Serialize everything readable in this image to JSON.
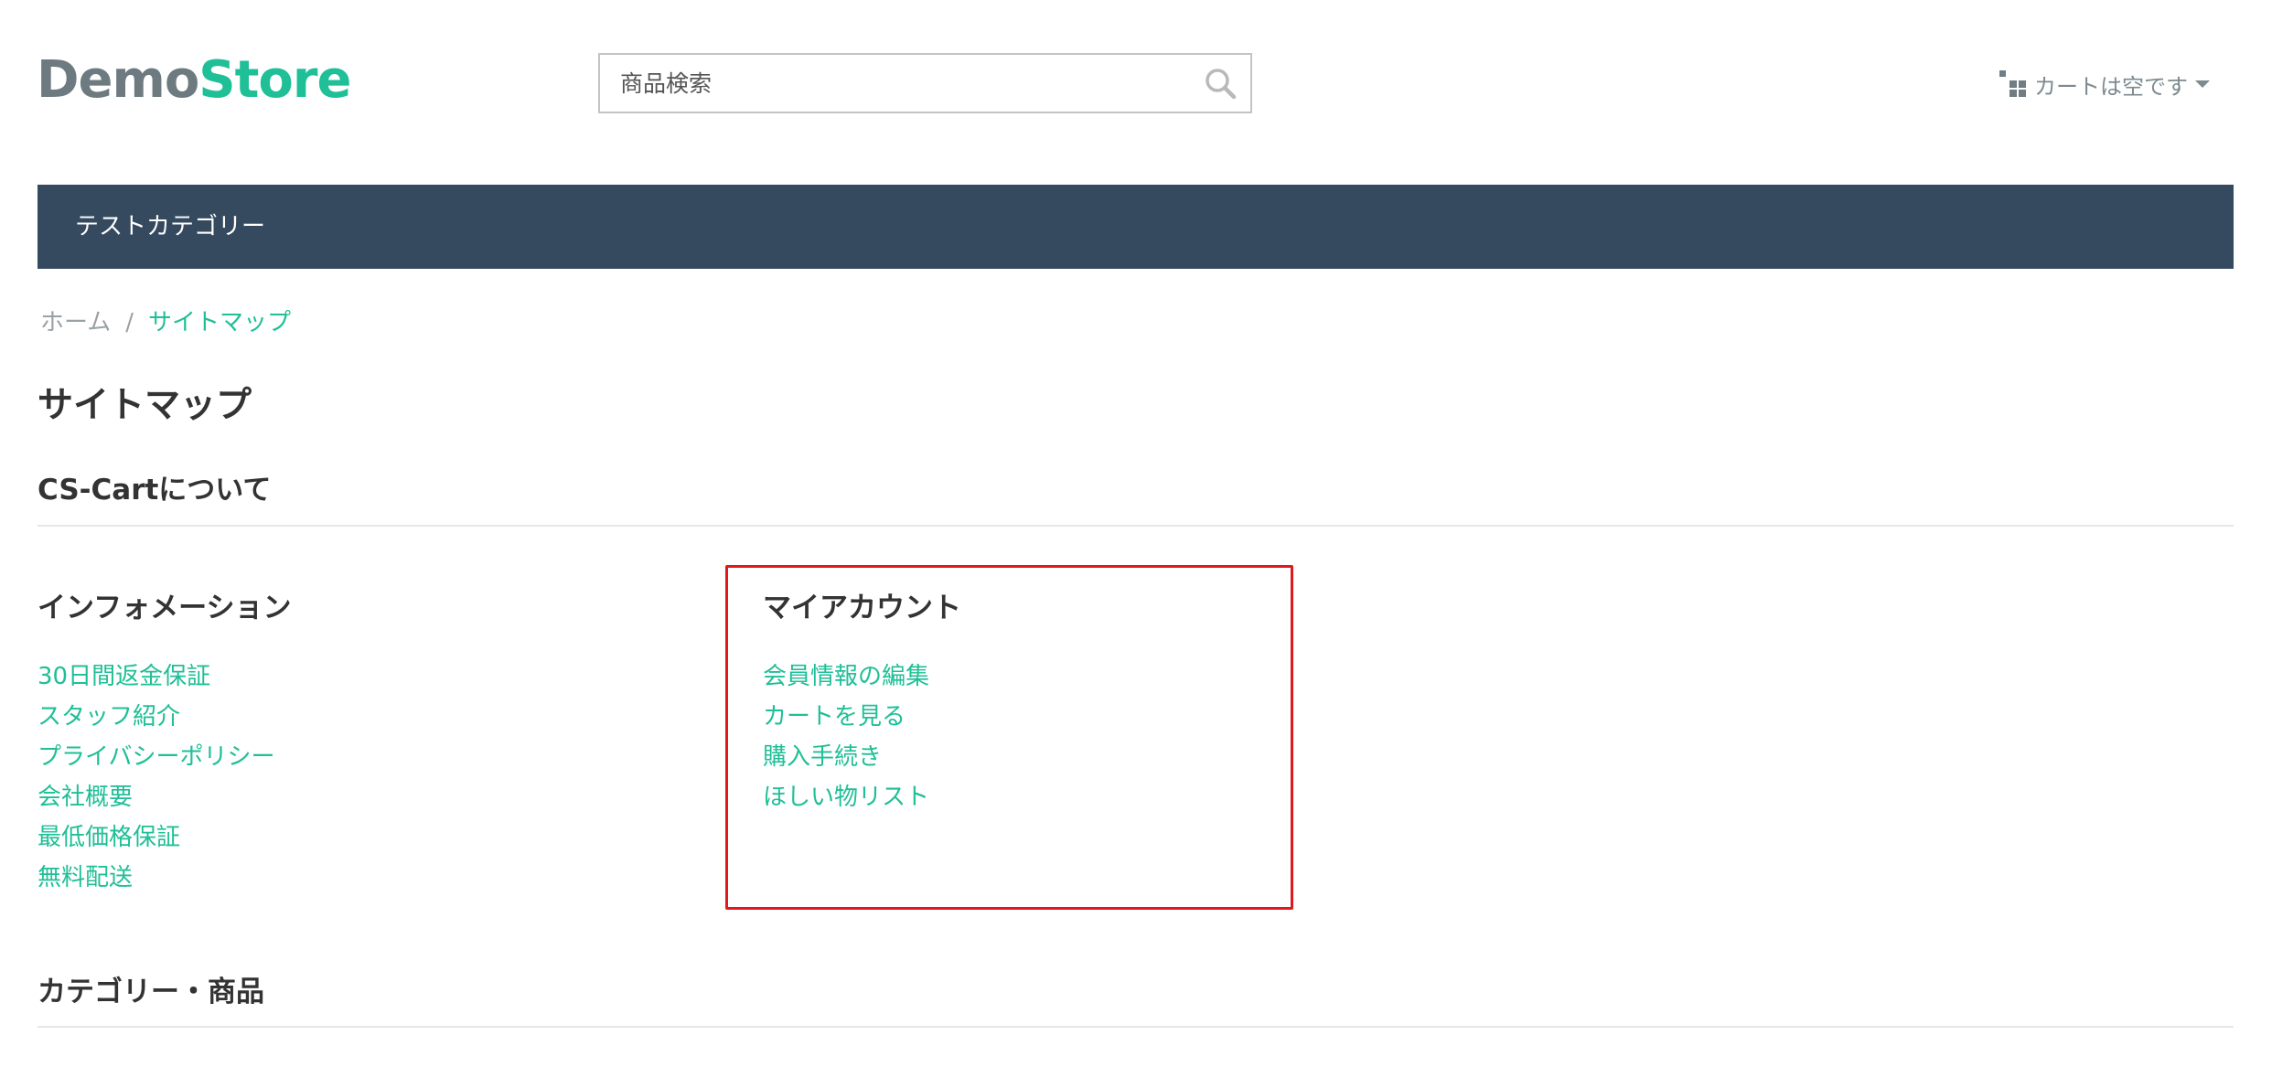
{
  "header": {
    "logo": {
      "part1": "Demo",
      "part2": "Store"
    },
    "search": {
      "placeholder": "商品検索",
      "value": ""
    },
    "cart": {
      "label": "カートは空です"
    }
  },
  "nav": {
    "items": [
      {
        "label": "テストカテゴリー"
      }
    ]
  },
  "breadcrumb": {
    "home": "ホーム",
    "separator": "/",
    "current": "サイトマップ"
  },
  "page": {
    "title": "サイトマップ",
    "sections": {
      "about": {
        "title": "CS-Cartについて"
      },
      "information": {
        "title": "インフォメーション",
        "links": [
          "30日間返金保証",
          "スタッフ紹介",
          "プライバシーポリシー",
          "会社概要",
          "最低価格保証",
          "無料配送"
        ]
      },
      "my_account": {
        "title": "マイアカウント",
        "links": [
          "会員情報の編集",
          "カートを見る",
          "購入手続き",
          "ほしい物リスト"
        ]
      },
      "categories": {
        "title": "カテゴリー・商品"
      }
    }
  },
  "colors": {
    "accent": "#1fbf97",
    "logo_gray": "#6d7a80",
    "nav_bg": "#354a5f",
    "highlight": "#e0191d"
  }
}
